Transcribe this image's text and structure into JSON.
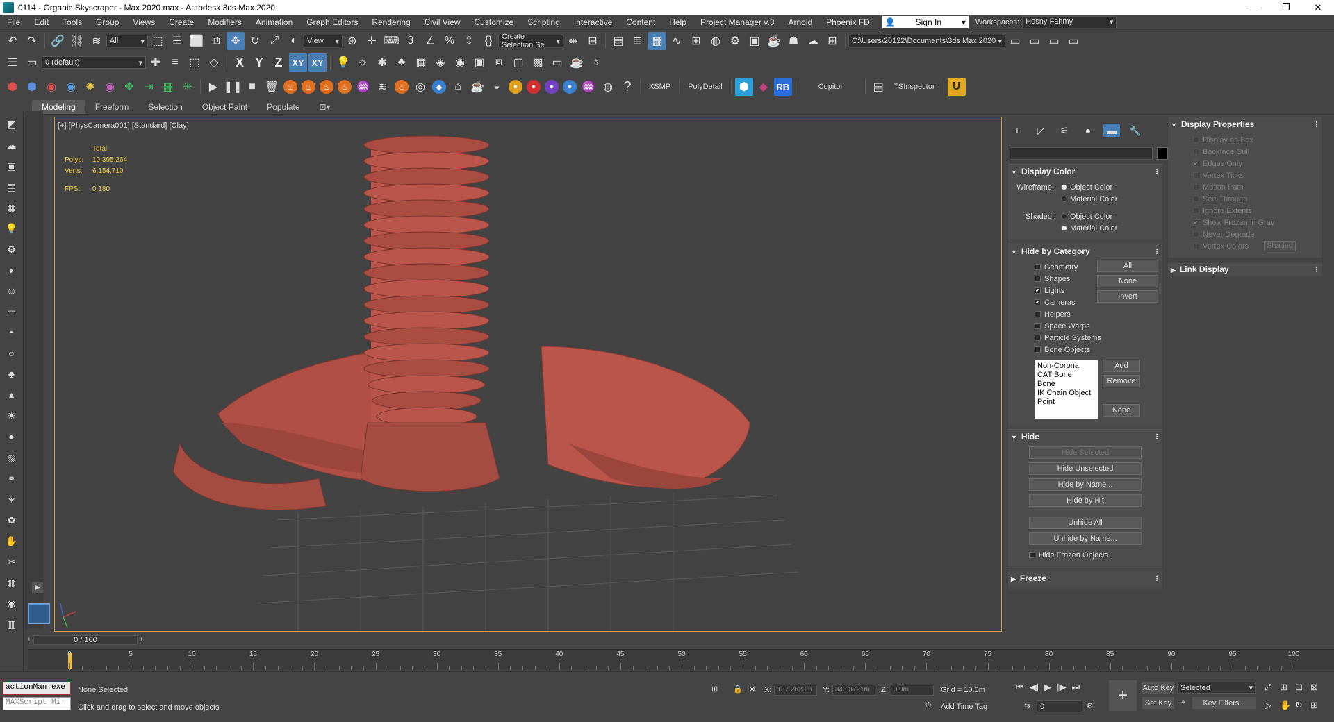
{
  "window": {
    "title": "0114 - Organic Skyscraper - Max 2020.max - Autodesk 3ds Max 2020",
    "minimize": "—",
    "maximize": "❐",
    "close": "✕"
  },
  "menu": [
    "File",
    "Edit",
    "Tools",
    "Group",
    "Views",
    "Create",
    "Modifiers",
    "Animation",
    "Graph Editors",
    "Rendering",
    "Civil View",
    "Customize",
    "Scripting",
    "Interactive",
    "Content",
    "Help",
    "Project Manager v.3",
    "Arnold",
    "Phoenix FD"
  ],
  "signin": {
    "label": "Sign In"
  },
  "workspaces": {
    "label": "Workspaces:",
    "value": "Hosny Fahmy"
  },
  "toolbar1": {
    "filter_value": "All",
    "refcoord_value": "View",
    "selection_set_placeholder": "Create Selection Se",
    "project_path": "C:\\Users\\20122\\Documents\\3ds Max 2020"
  },
  "toolbar2": {
    "layer_value": "0 (default)",
    "axis_x": "X",
    "axis_y": "Y",
    "axis_z": "Z",
    "axis_xy": "XY",
    "axis_xy2": "XY"
  },
  "toolbar3": {
    "xsmp": "XSMP",
    "polydetail": "PolyDetail",
    "rb": "RB",
    "copitor": "Copitor",
    "tsinspector": "TSInspector",
    "help": "?"
  },
  "ribbon": {
    "tabs": [
      "Modeling",
      "Freeform",
      "Selection",
      "Object Paint",
      "Populate"
    ],
    "active": "Modeling"
  },
  "viewport": {
    "label": "[+] [PhysCamera001] [Standard] [Clay]",
    "stats_header": "Total",
    "polys_label": "Polys:",
    "polys_value": "10,395,264",
    "verts_label": "Verts:",
    "verts_value": "6,154,710",
    "fps_label": "FPS:",
    "fps_value": "0.180",
    "model_color": "#b9554a"
  },
  "panel": {
    "display_color": {
      "title": "Display Color",
      "wireframe_label": "Wireframe:",
      "shaded_label": "Shaded:",
      "object_color": "Object Color",
      "material_color": "Material Color"
    },
    "hide_by_category": {
      "title": "Hide by Category",
      "items": [
        {
          "label": "Geometry",
          "checked": false
        },
        {
          "label": "Shapes",
          "checked": false
        },
        {
          "label": "Lights",
          "checked": true
        },
        {
          "label": "Cameras",
          "checked": true
        },
        {
          "label": "Helpers",
          "checked": false
        },
        {
          "label": "Space Warps",
          "checked": false
        },
        {
          "label": "Particle Systems",
          "checked": false
        },
        {
          "label": "Bone Objects",
          "checked": false
        }
      ],
      "btn_all": "All",
      "btn_none": "None",
      "btn_invert": "Invert",
      "list": [
        "Non-Corona",
        "CAT Bone",
        "Bone",
        "IK Chain Object",
        "Point"
      ],
      "btn_add": "Add",
      "btn_remove": "Remove",
      "btn_none2": "None"
    },
    "hide": {
      "title": "Hide",
      "hide_selected": "Hide Selected",
      "hide_unselected": "Hide Unselected",
      "hide_by_name": "Hide by Name...",
      "hide_by_hit": "Hide by Hit",
      "unhide_all": "Unhide All",
      "unhide_by_name": "Unhide by Name...",
      "hide_frozen": "Hide Frozen Objects"
    },
    "freeze": {
      "title": "Freeze"
    },
    "display_properties": {
      "title": "Display Properties",
      "items": [
        {
          "label": "Display as Box",
          "checked": false
        },
        {
          "label": "Backface Cull",
          "checked": false
        },
        {
          "label": "Edges Only",
          "checked": true
        },
        {
          "label": "Vertex Ticks",
          "checked": false
        },
        {
          "label": "Motion Path",
          "checked": false
        },
        {
          "label": "See-Through",
          "checked": false
        },
        {
          "label": "Ignore Extents",
          "checked": false
        },
        {
          "label": "Show Frozen in Gray",
          "checked": true
        },
        {
          "label": "Never Degrade",
          "checked": false
        },
        {
          "label": "Vertex Colors",
          "checked": false
        }
      ],
      "shaded_btn": "Shaded"
    },
    "link_display": {
      "title": "Link Display"
    }
  },
  "timeline": {
    "slider": "0 / 100",
    "ticks": [
      0,
      5,
      10,
      15,
      20,
      25,
      30,
      35,
      40,
      45,
      50,
      55,
      60,
      65,
      70,
      75,
      80,
      85,
      90,
      95,
      100
    ]
  },
  "status": {
    "maxscript1": "actionMan.exe",
    "maxscript2": "MAXScript Mi:",
    "none_selected": "None Selected",
    "prompt": "Click and drag to select and move objects",
    "x_label": "X:",
    "x_value": "187.2623m",
    "y_label": "Y:",
    "y_value": "343.3721m",
    "z_label": "Z:",
    "z_value": "0.0m",
    "grid": "Grid = 10.0m",
    "add_time_tag": "Add Time Tag",
    "auto_key": "Auto Key",
    "set_key": "Set Key",
    "selected": "Selected",
    "key_filters": "Key Filters...",
    "frame": "0"
  }
}
